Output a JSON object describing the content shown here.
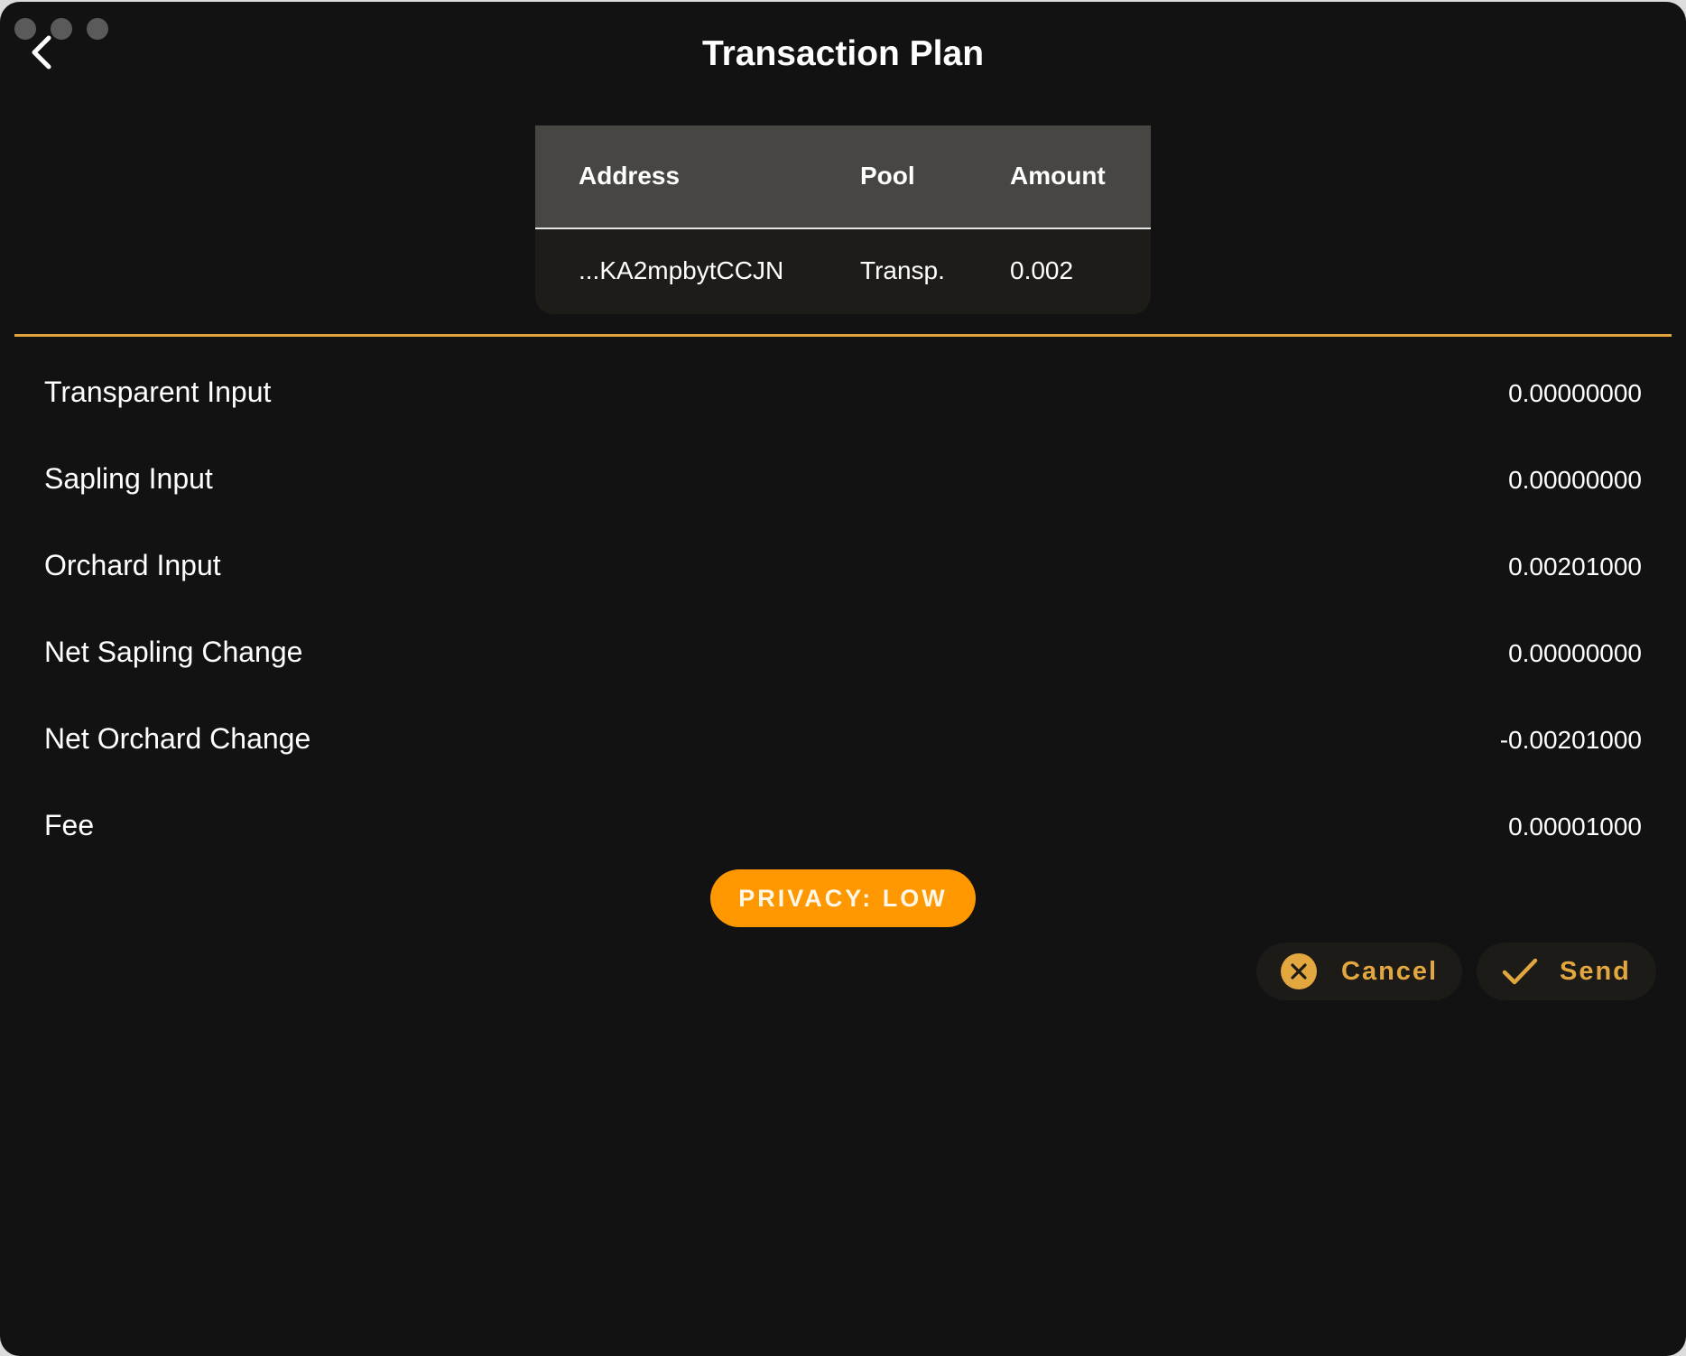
{
  "header": {
    "title": "Transaction Plan"
  },
  "recipients": {
    "columns": [
      "Address",
      "Pool",
      "Amount"
    ],
    "rows": [
      {
        "address": "...KA2mpbytCCJN",
        "pool": "Transp.",
        "amount": "0.002"
      }
    ]
  },
  "summary": [
    {
      "label": "Transparent Input",
      "value": "0.00000000"
    },
    {
      "label": "Sapling Input",
      "value": "0.00000000"
    },
    {
      "label": "Orchard Input",
      "value": "0.00201000"
    },
    {
      "label": "Net Sapling Change",
      "value": "0.00000000"
    },
    {
      "label": "Net Orchard Change",
      "value": "-0.00201000"
    },
    {
      "label": "Fee",
      "value": "0.00001000"
    }
  ],
  "privacy_badge": "PRIVACY: LOW",
  "actions": {
    "cancel_label": "Cancel",
    "send_label": "Send"
  },
  "icons": {
    "back": "chevron-left-icon",
    "cancel": "close-circle-icon",
    "send": "check-icon"
  },
  "colors": {
    "background": "#121212",
    "accent": "#e2a23c",
    "privacy_low": "#ff9700",
    "table_header": "#474643"
  }
}
